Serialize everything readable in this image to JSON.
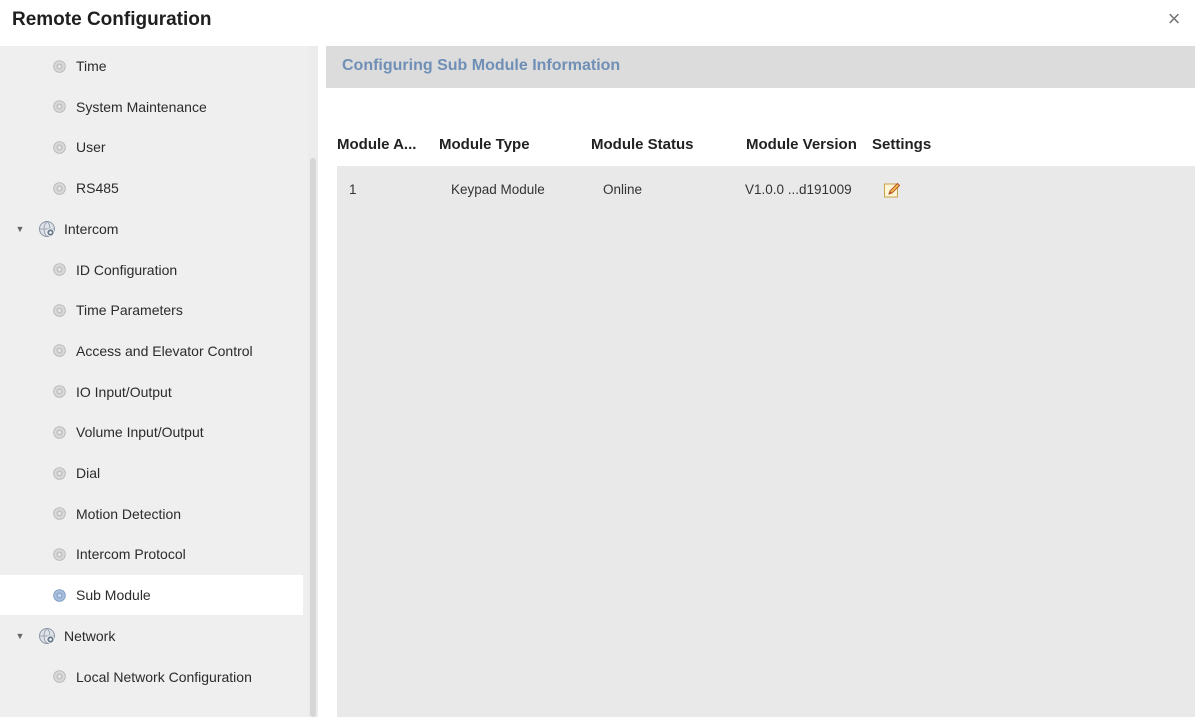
{
  "window": {
    "title": "Remote Configuration",
    "close_icon": "close-icon"
  },
  "sidebar": {
    "items": [
      {
        "label": "Time",
        "kind": "child",
        "icon": "gear-icon"
      },
      {
        "label": "System Maintenance",
        "kind": "child",
        "icon": "gear-icon"
      },
      {
        "label": "User",
        "kind": "child",
        "icon": "gear-icon"
      },
      {
        "label": "RS485",
        "kind": "child",
        "icon": "gear-icon"
      },
      {
        "label": "Intercom",
        "kind": "group",
        "icon": "globe-gear-icon",
        "expanded": true
      },
      {
        "label": "ID Configuration",
        "kind": "child",
        "icon": "gear-icon"
      },
      {
        "label": "Time Parameters",
        "kind": "child",
        "icon": "gear-icon"
      },
      {
        "label": "Access and Elevator Control",
        "kind": "child",
        "icon": "gear-icon"
      },
      {
        "label": "IO Input/Output",
        "kind": "child",
        "icon": "gear-icon"
      },
      {
        "label": "Volume Input/Output",
        "kind": "child",
        "icon": "gear-icon"
      },
      {
        "label": "Dial",
        "kind": "child",
        "icon": "gear-icon"
      },
      {
        "label": "Motion Detection",
        "kind": "child",
        "icon": "gear-icon"
      },
      {
        "label": "Intercom Protocol",
        "kind": "child",
        "icon": "gear-icon"
      },
      {
        "label": "Sub Module",
        "kind": "child",
        "icon": "gear-icon",
        "selected": true
      },
      {
        "label": "Network",
        "kind": "group",
        "icon": "globe-gear-icon",
        "expanded": true
      },
      {
        "label": "Local Network Configuration",
        "kind": "child",
        "icon": "gear-icon"
      }
    ]
  },
  "main": {
    "title": "Configuring Sub Module Information",
    "table": {
      "columns": [
        "Module A...",
        "Module Type",
        "Module Status",
        "Module Version",
        "Settings"
      ],
      "rows": [
        {
          "address": "1",
          "type": "Keypad Module",
          "status": "Online",
          "version": "V1.0.0 ...d191009",
          "settings_icon": "edit-icon"
        }
      ]
    }
  },
  "colors": {
    "sidebar_bg": "#efefef",
    "header_bg": "#dcdcdc",
    "title_accent": "#6f8fb6",
    "table_body_bg": "#e9e9e9",
    "selected_bg": "#ffffff"
  }
}
